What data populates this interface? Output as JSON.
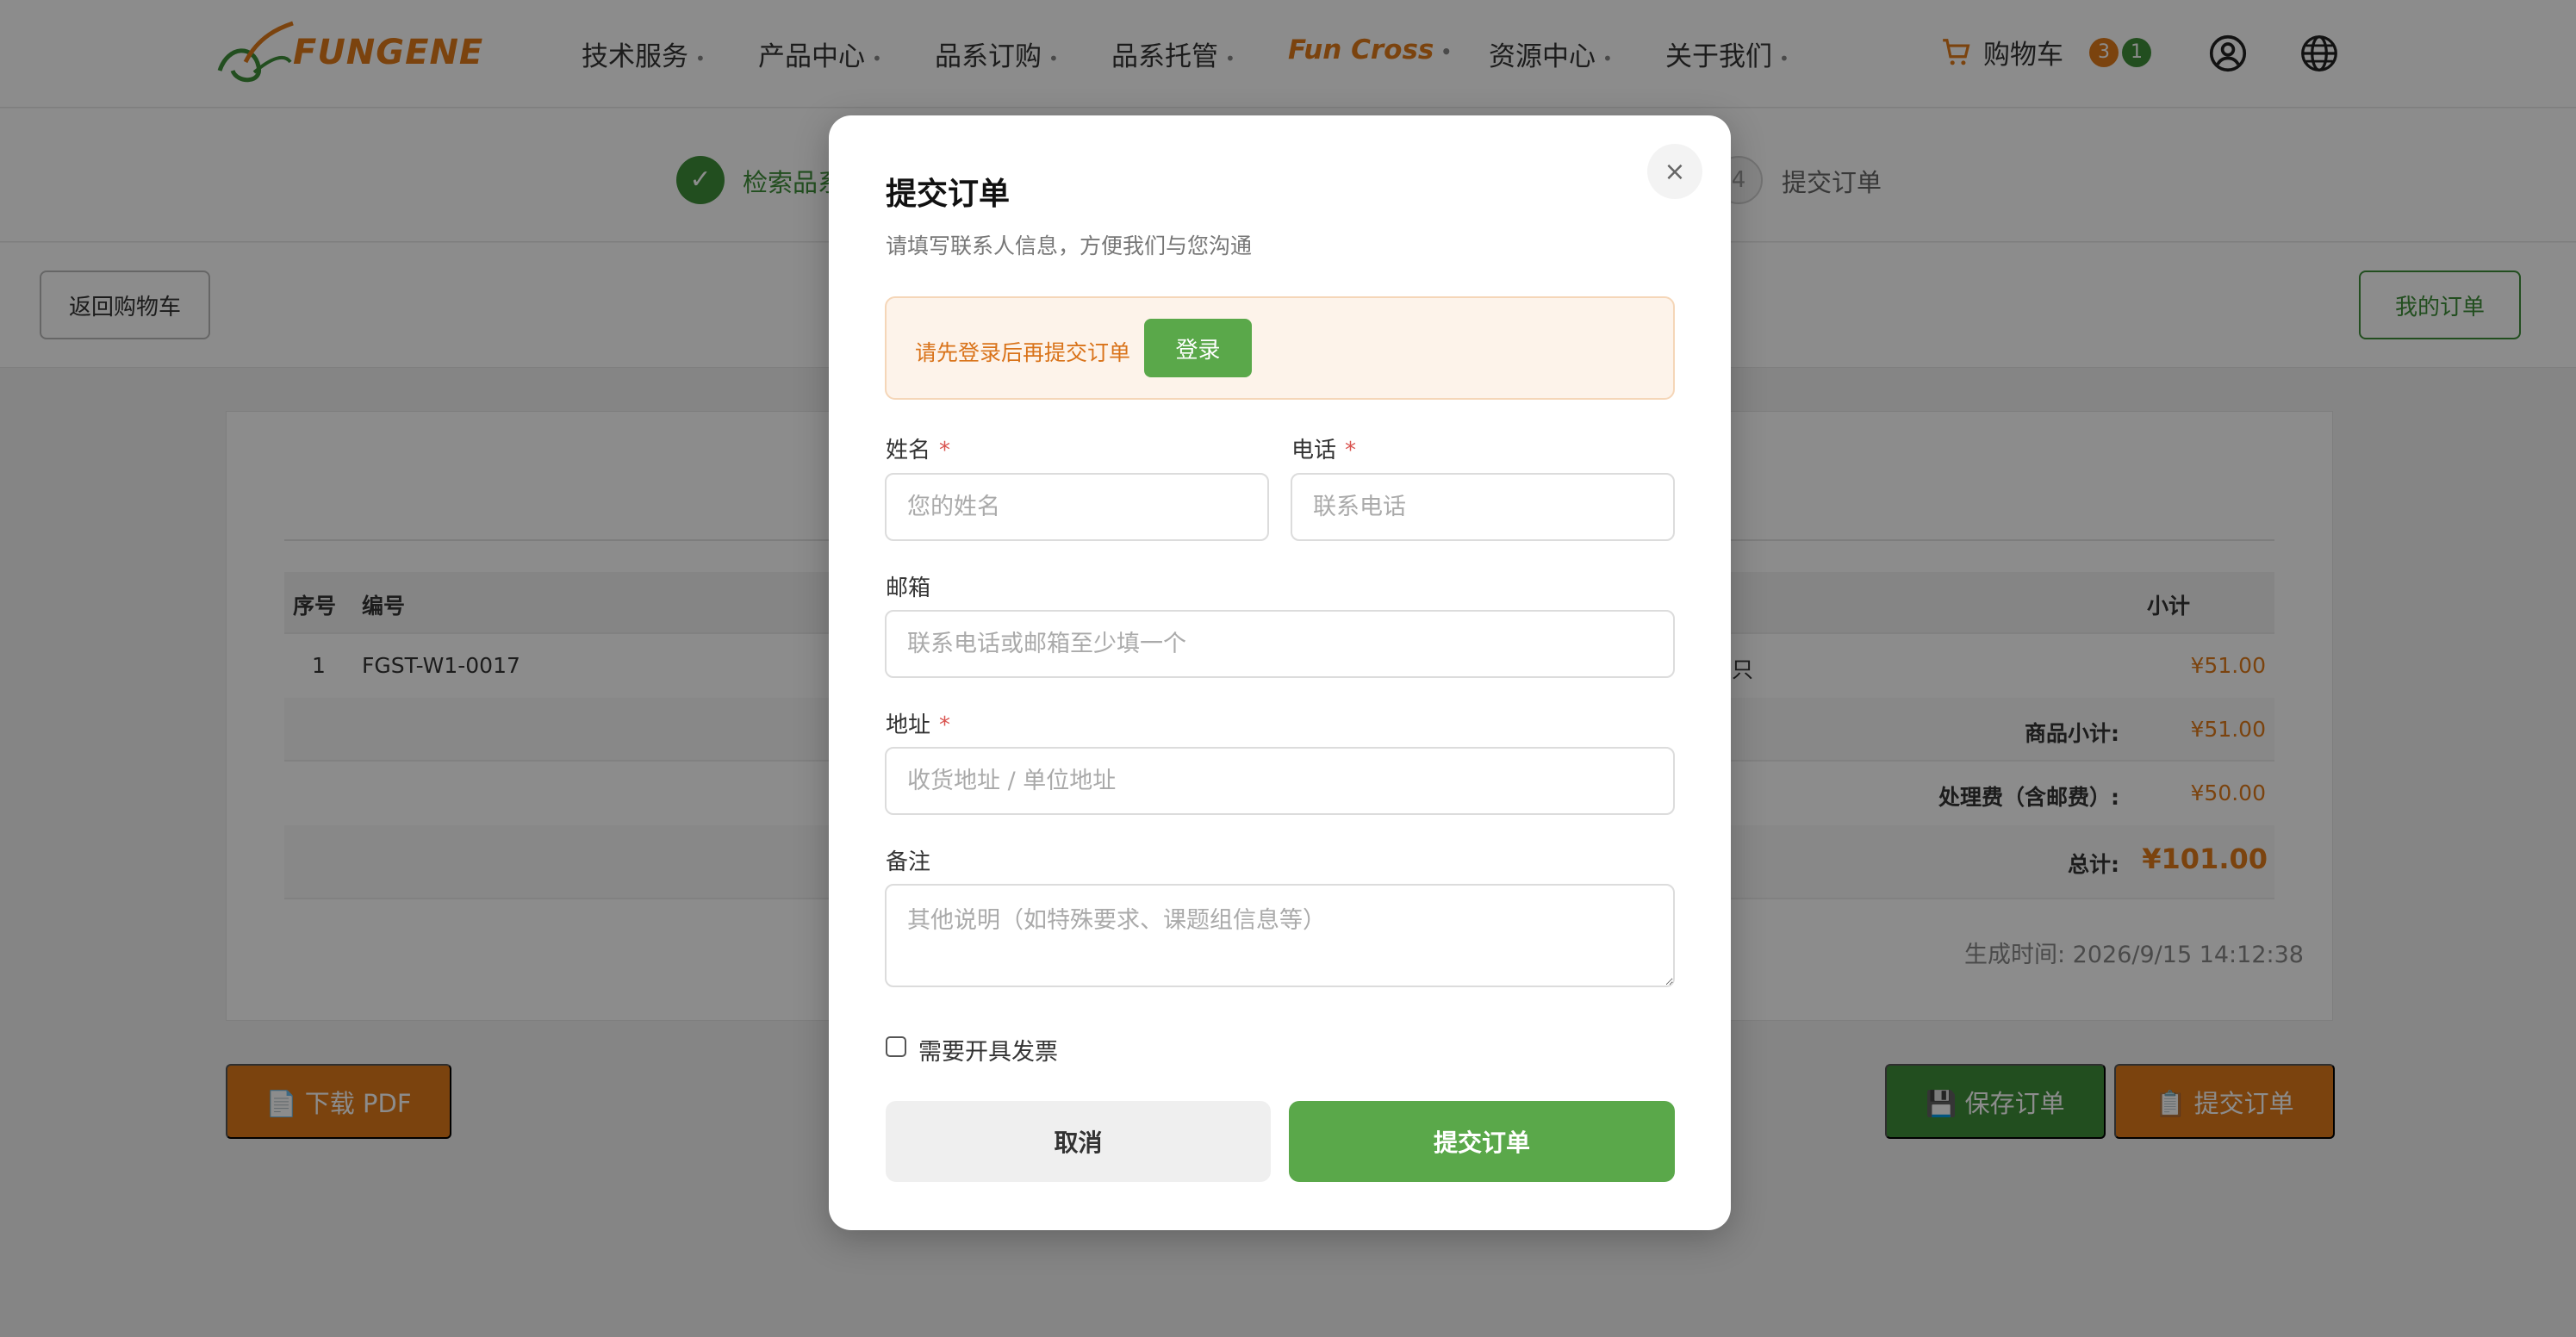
{
  "header": {
    "logo_text": "FUNGENE",
    "nav": [
      "技术服务",
      "产品中心",
      "品系订购",
      "品系托管",
      "Fun Cross",
      "资源中心",
      "关于我们"
    ],
    "cart_label": "购物车",
    "cart_badges": [
      "3",
      "1"
    ],
    "colors": {
      "accent_orange": "#e07b1a",
      "accent_green": "#3f8f3a"
    }
  },
  "steps": {
    "step1_check": "✓",
    "step1_label": "检索品系",
    "step4_number": "4",
    "step4_label": "提交订单"
  },
  "actions": {
    "back_label": "返回购物车",
    "my_orders_label": "我的订单"
  },
  "table": {
    "headers": {
      "index": "序号",
      "code": "编号",
      "subtotal": "小计"
    },
    "rows": [
      {
        "index": "1",
        "code": "FGST-W1-0017",
        "unit_fragment": "只",
        "subtotal": "¥51.00"
      }
    ],
    "summary": {
      "goods_label": "商品小计:",
      "goods_value": "¥51.00",
      "fee_label": "处理费（含邮费）:",
      "fee_value": "¥50.00",
      "total_label": "总计:",
      "total_value": "¥101.00"
    },
    "generated_time": "生成时间: 2026/9/15 14:12:38"
  },
  "bottom_buttons": {
    "pdf": "📄 下载 PDF",
    "save": "💾 保存订单",
    "submit": "📋 提交订单"
  },
  "modal": {
    "close": "×",
    "title": "提交订单",
    "subtitle": "请填写联系人信息，方便我们与您沟通",
    "login_notice": "请先登录后再提交订单",
    "login_button": "登录",
    "fields": {
      "name": {
        "label": "姓名",
        "required_mark": "*",
        "placeholder": "您的姓名",
        "value": ""
      },
      "phone": {
        "label": "电话",
        "required_mark": "*",
        "placeholder": "联系电话",
        "value": ""
      },
      "email": {
        "label": "邮箱",
        "placeholder": "联系电话或邮箱至少填一个",
        "value": ""
      },
      "address": {
        "label": "地址",
        "required_mark": "*",
        "placeholder": "收货地址 / 单位地址",
        "value": ""
      },
      "notes": {
        "label": "备注",
        "placeholder": "其他说明（如特殊要求、课题组信息等）",
        "value": ""
      }
    },
    "invoice_label": "需要开具发票",
    "cancel_button": "取消",
    "submit_button": "提交订单"
  }
}
